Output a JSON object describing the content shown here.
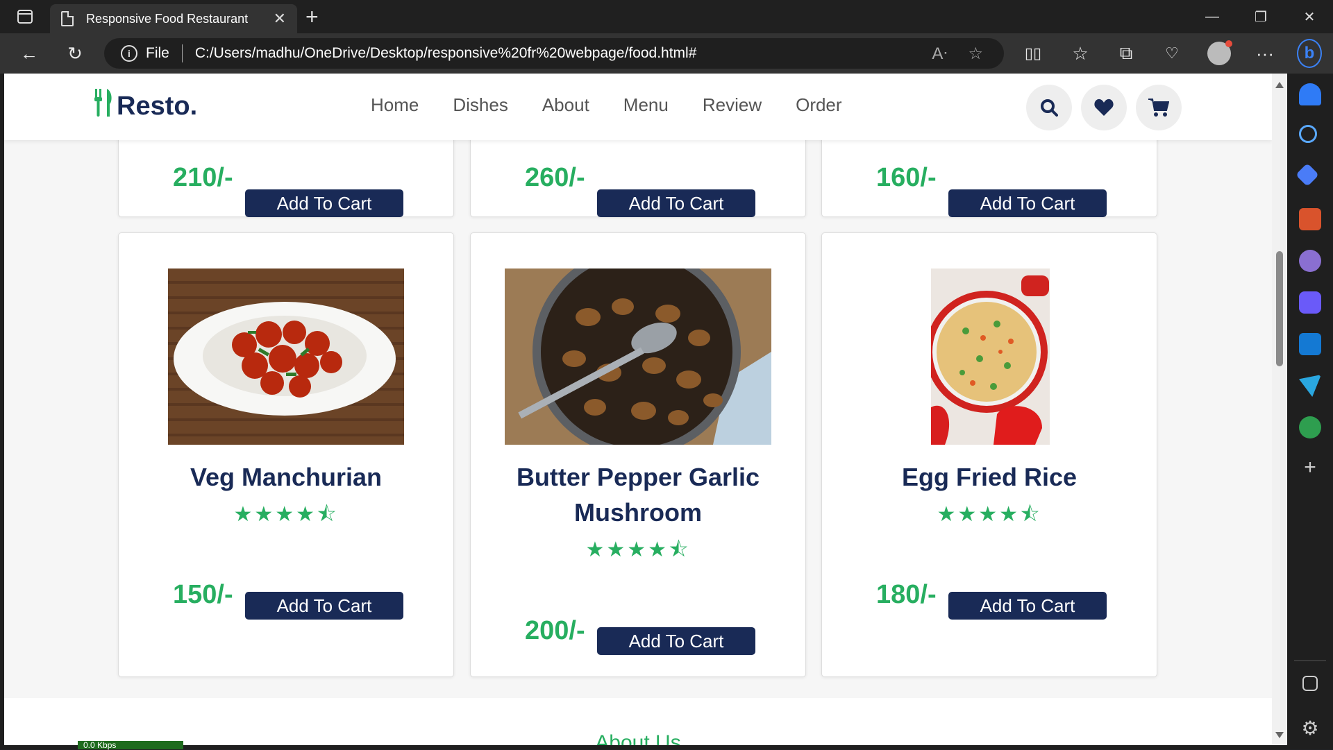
{
  "browser": {
    "tab_title": "Responsive Food Restaurant",
    "address_scheme": "File",
    "address_url": "C:/Users/madhu/OneDrive/Desktop/responsive%20fr%20webpage/food.html#"
  },
  "site": {
    "logo_text": "Resto.",
    "nav": [
      "Home",
      "Dishes",
      "About",
      "Menu",
      "Review",
      "Order"
    ],
    "accent_color": "#27ae60",
    "primary_color": "#192a56"
  },
  "top_cards": [
    {
      "price": "210/-",
      "button": "Add To Cart"
    },
    {
      "price": "260/-",
      "button": "Add To Cart"
    },
    {
      "price": "160/-",
      "button": "Add To Cart"
    }
  ],
  "dishes": [
    {
      "name": "Veg Manchurian",
      "rating": 4.5,
      "stars": "★★★★⯪",
      "price": "150/-",
      "button": "Add To Cart"
    },
    {
      "name": "Butter Pepper Garlic Mushroom",
      "rating": 4.5,
      "stars": "★★★★⯪",
      "price": "200/-",
      "button": "Add To Cart"
    },
    {
      "name": "Egg Fried Rice",
      "rating": 4.5,
      "stars": "★★★★⯪",
      "price": "180/-",
      "button": "Add To Cart"
    }
  ],
  "next_section_title": "About Us",
  "status_badge": "0.0 Kbps"
}
